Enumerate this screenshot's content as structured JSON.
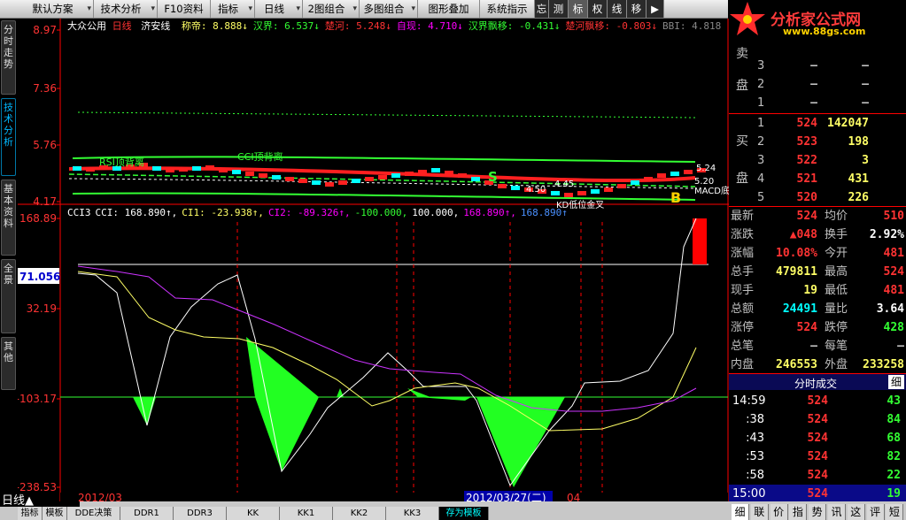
{
  "toolbar": {
    "items": [
      {
        "label": "默认方案",
        "dd": true
      },
      {
        "label": "技术分析",
        "dd": true
      },
      {
        "label": "F10资料",
        "dd": false
      },
      {
        "label": "指标",
        "dd": true
      },
      {
        "label": "日线",
        "dd": true
      },
      {
        "label": "2图组合",
        "dd": true
      },
      {
        "label": "多图组合",
        "dd": true
      },
      {
        "label": "图形叠加",
        "dd": false
      },
      {
        "label": "系统指示",
        "dd": false
      },
      {
        "label": "忘",
        "dd": false
      },
      {
        "label": "测",
        "dd": false
      },
      {
        "label": "标",
        "dd": false
      },
      {
        "label": "权",
        "dd": false
      },
      {
        "label": "线",
        "dd": false
      },
      {
        "label": "移",
        "dd": false
      },
      {
        "label": "▶",
        "dd": false
      }
    ]
  },
  "logo": {
    "text": "分析家公式网",
    "url": "www.88gs.com"
  },
  "left_tabs": [
    {
      "label": "分时走势",
      "active": false
    },
    {
      "label": "技术分析",
      "active": true
    },
    {
      "label": "基本资料",
      "active": false
    },
    {
      "label": "全景",
      "active": false
    },
    {
      "label": "其他",
      "active": false
    }
  ],
  "main_panel": {
    "stock_name": "大众公用",
    "period": "日线",
    "indicator": "济安线",
    "info": [
      {
        "text": "称帝: 8.888↓",
        "color": "#ffff66"
      },
      {
        "text": "汉界: 6.537↓",
        "color": "#33ff33"
      },
      {
        "text": "楚河: 5.248↓",
        "color": "#ff3333"
      },
      {
        "text": "自现: 4.710↓",
        "color": "#ff00ff"
      },
      {
        "text": "汉界飘移: -0.431↓",
        "color": "#33ff33"
      },
      {
        "text": "楚河飘移: -0.803↓",
        "color": "#ff3333"
      },
      {
        "text": "BBI: 4.818",
        "color": "#888888"
      }
    ],
    "y_ticks": [
      "8.97",
      "7.36",
      "5.76",
      "4.17"
    ],
    "annotations": [
      "RSI顶背离",
      "CCI顶背离",
      "KD低位金叉",
      "MACD底背离"
    ],
    "markers": [
      "S",
      "B"
    ],
    "price_labels": [
      "5.24",
      "4.50",
      "4.45",
      "5.20"
    ]
  },
  "sub_panel": {
    "header": [
      {
        "text": "CCI3",
        "color": "#ffffff"
      },
      {
        "text": "CCI: 168.890↑,",
        "color": "#ffffff"
      },
      {
        "text": "CI1: -23.938↑,",
        "color": "#ffff66"
      },
      {
        "text": "CI2: -89.326↑,",
        "color": "#ff00ff"
      },
      {
        "text": "-100.000,",
        "color": "#33ff33"
      },
      {
        "text": "100.000,",
        "color": "#ffffff"
      },
      {
        "text": "168.890↑,",
        "color": "#ff00ff"
      },
      {
        "text": "168.890↑",
        "color": "#4a90ff"
      }
    ],
    "y_ticks": [
      "168.89",
      "32.19",
      "-103.17",
      "-238.53"
    ],
    "highlight_value": "71.056"
  },
  "date_axis": {
    "left": "2012/03",
    "cursor": "2012/03/27(二)",
    "right": "04"
  },
  "bottom_tabs": {
    "period_label": "日线▲",
    "items": [
      "指标",
      "模板",
      "DDE决策",
      "DDR1",
      "DDR3",
      "KK",
      "KK1",
      "KK2",
      "KK3",
      "存为模板"
    ],
    "right_tabs": [
      "细",
      "联",
      "价",
      "指",
      "势",
      "讯",
      "这",
      "评",
      "短"
    ]
  },
  "orderbook": {
    "sell_label": [
      "卖",
      "盘"
    ],
    "buy_label": [
      "买",
      "盘"
    ],
    "sell": [
      {
        "level": "3",
        "price": "–",
        "volume": "–"
      },
      {
        "level": "2",
        "price": "–",
        "volume": "–"
      },
      {
        "level": "1",
        "price": "–",
        "volume": "–"
      }
    ],
    "buy": [
      {
        "level": "1",
        "price": "524",
        "volume": "142047"
      },
      {
        "level": "2",
        "price": "523",
        "volume": "198"
      },
      {
        "level": "3",
        "price": "522",
        "volume": "3"
      },
      {
        "level": "4",
        "price": "521",
        "volume": "431"
      },
      {
        "level": "5",
        "price": "520",
        "volume": "226"
      }
    ]
  },
  "quote": {
    "rows": [
      {
        "l1": "最新",
        "v1": "524",
        "c1": "#ff3333",
        "l2": "均价",
        "v2": "510",
        "c2": "#ff3333"
      },
      {
        "l1": "涨跌",
        "v1": "▲048",
        "c1": "#ff3333",
        "l2": "换手",
        "v2": "2.92%",
        "c2": "#ffffff"
      },
      {
        "l1": "涨幅",
        "v1": "10.08%",
        "c1": "#ff3333",
        "l2": "今开",
        "v2": "481",
        "c2": "#ff3333"
      },
      {
        "l1": "总手",
        "v1": "479811",
        "c1": "#ffff66",
        "l2": "最高",
        "v2": "524",
        "c2": "#ff3333"
      },
      {
        "l1": "现手",
        "v1": "19",
        "c1": "#ffff66",
        "l2": "最低",
        "v2": "481",
        "c2": "#ff3333"
      },
      {
        "l1": "总额",
        "v1": "24491",
        "c1": "#00ffff",
        "l2": "量比",
        "v2": "3.64",
        "c2": "#ffffff"
      },
      {
        "l1": "涨停",
        "v1": "524",
        "c1": "#ff3333",
        "l2": "跌停",
        "v2": "428",
        "c2": "#33ff33"
      },
      {
        "l1": "总笔",
        "v1": "–",
        "c1": "#c0c0c0",
        "l2": "每笔",
        "v2": "–",
        "c2": "#c0c0c0"
      },
      {
        "l1": "内盘",
        "v1": "246553",
        "c1": "#ffff66",
        "l2": "外盘",
        "v2": "233258",
        "c2": "#ffff66"
      }
    ]
  },
  "trades": {
    "header": "分时成交",
    "detail_label": "细",
    "rows": [
      {
        "time": "14:59",
        "price": "524",
        "volume": "43"
      },
      {
        "time": ":38",
        "price": "524",
        "volume": "84"
      },
      {
        "time": ":43",
        "price": "524",
        "volume": "68"
      },
      {
        "time": ":53",
        "price": "524",
        "volume": "82"
      },
      {
        "time": ":58",
        "price": "524",
        "volume": "22"
      },
      {
        "time": "15:00",
        "price": "524",
        "volume": "19"
      }
    ]
  },
  "colors": {
    "up": "#ff3333",
    "down": "#33ff33",
    "axis": "#ff0000",
    "cyan": "#00ffff"
  }
}
